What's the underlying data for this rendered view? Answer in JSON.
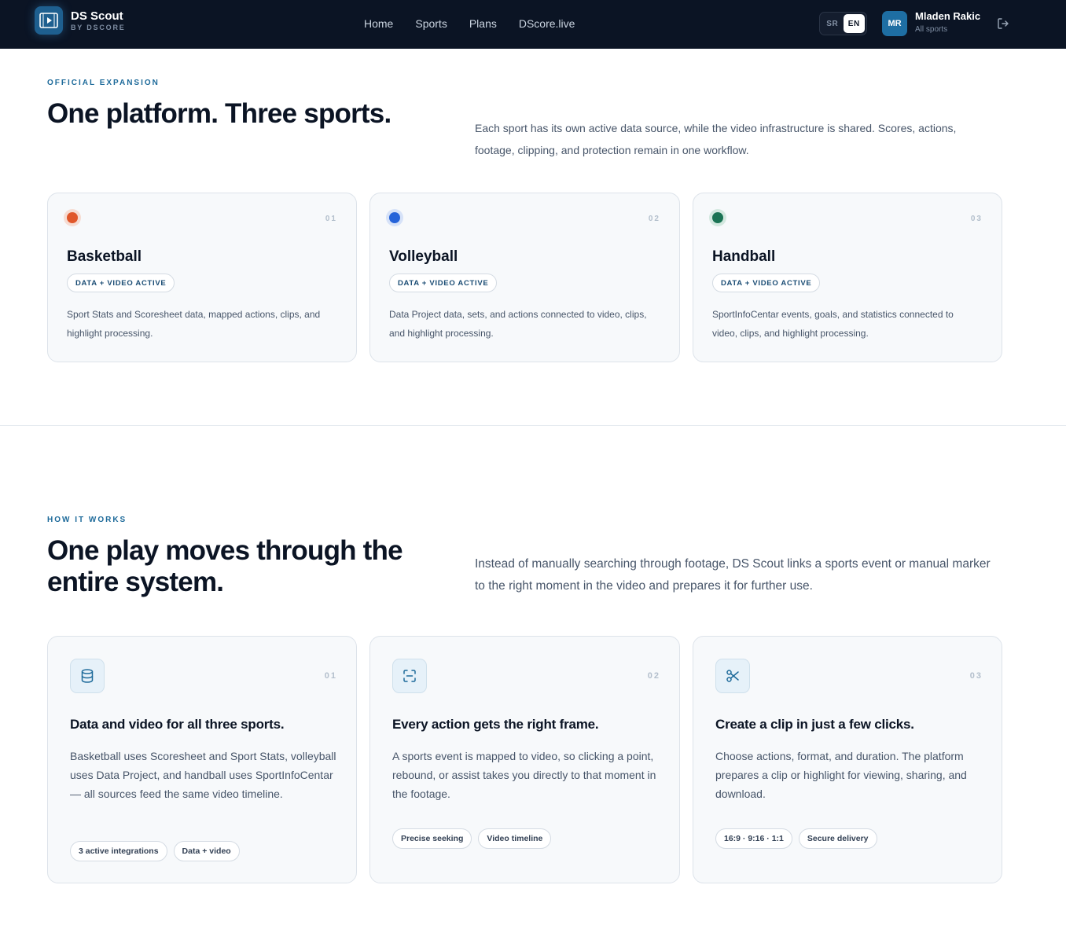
{
  "header": {
    "brand_title": "DS Scout",
    "brand_sub": "BY DSCORE",
    "nav": [
      "Home",
      "Sports",
      "Plans",
      "DScore.live"
    ],
    "lang": [
      "SR",
      "EN"
    ],
    "user_initials": "MR",
    "user_name": "Mladen Rakic",
    "user_sub": "All sports"
  },
  "expansion": {
    "eyebrow": "OFFICIAL EXPANSION",
    "title": "One platform. Three sports.",
    "lead": "Each sport has its own active data source, while the video infrastructure is shared. Scores, actions, footage, clipping, and protection remain in one workflow.",
    "cards": [
      {
        "num": "01",
        "title": "Basketball",
        "badge": "DATA + VIDEO ACTIVE",
        "desc": "Sport Stats and Scoresheet data, mapped actions, clips, and highlight processing.",
        "color": "#e0572a",
        "ring": "#f6dcd2"
      },
      {
        "num": "02",
        "title": "Volleyball",
        "badge": "DATA + VIDEO ACTIVE",
        "desc": "Data Project data, sets, and actions connected to video, clips, and highlight processing.",
        "color": "#2563d9",
        "ring": "#d6e2f8"
      },
      {
        "num": "03",
        "title": "Handball",
        "badge": "DATA + VIDEO ACTIVE",
        "desc": "SportInfoCentar events, goals, and statistics connected to video, clips, and highlight processing.",
        "color": "#1b7354",
        "ring": "#d3e8df"
      }
    ]
  },
  "how": {
    "eyebrow": "HOW IT WORKS",
    "title": "One play moves through the entire system.",
    "lead": "Instead of manually searching through footage, DS Scout links a sports event or manual marker to the right moment in the video and prepares it for further use.",
    "steps": [
      {
        "num": "01",
        "icon": "database-icon",
        "title": "Data and video for all three sports.",
        "desc": "Basketball uses Scoresheet and Sport Stats, volleyball uses Data Project, and handball uses SportInfoCentar — all sources feed the same video timeline.",
        "chips": [
          "3 active integrations",
          "Data + video"
        ]
      },
      {
        "num": "02",
        "icon": "scan-icon",
        "title": "Every action gets the right frame.",
        "desc": "A sports event is mapped to video, so clicking a point, rebound, or assist takes you directly to that moment in the footage.",
        "chips": [
          "Precise seeking",
          "Video timeline"
        ]
      },
      {
        "num": "03",
        "icon": "scissors-icon",
        "title": "Create a clip in just a few clicks.",
        "desc": "Choose actions, format, and duration. The platform prepares a clip or highlight for viewing, sharing, and download.",
        "chips": [
          "16:9 · 9:16 · 1:1",
          "Secure delivery"
        ]
      }
    ]
  }
}
